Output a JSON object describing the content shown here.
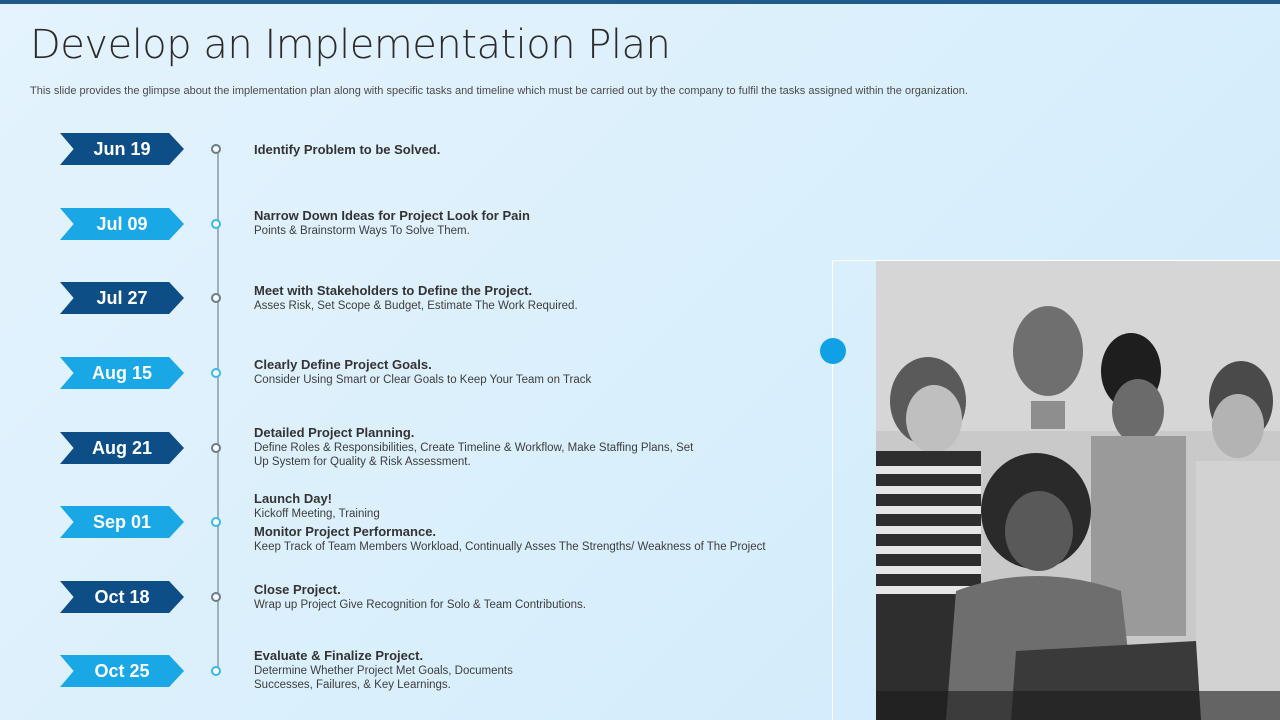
{
  "slide": {
    "title": "Develop an Implementation Plan",
    "subtitle": "This slide provides the glimpse about the implementation plan along with specific tasks and timeline which must be carried out by the company to fulfil the tasks assigned within the organization."
  },
  "timeline": [
    {
      "date": "Jun 19",
      "style": "dark",
      "heading": "Identify Problem to be Solved.",
      "lines": []
    },
    {
      "date": "Jul 09",
      "style": "light",
      "heading": "Narrow Down Ideas for Project Look for Pain",
      "lines": [
        "Points & Brainstorm Ways To Solve Them."
      ]
    },
    {
      "date": "Jul 27",
      "style": "dark",
      "heading": "Meet with Stakeholders to Define the Project.",
      "lines": [
        "Asses Risk, Set Scope & Budget, Estimate The Work Required."
      ]
    },
    {
      "date": "Aug 15",
      "style": "light",
      "heading": "Clearly Define Project Goals.",
      "lines": [
        "Consider Using Smart or Clear Goals to Keep Your Team on Track"
      ]
    },
    {
      "date": "Aug 21",
      "style": "dark",
      "heading": "Detailed Project Planning.",
      "lines": [
        "Define Roles & Responsibilities, Create Timeline & Workflow, Make Staffing Plans, Set",
        "Up System for Quality & Risk Assessment."
      ]
    },
    {
      "date": "Sep 01",
      "style": "light",
      "heading": "Launch Day!",
      "lines": [
        "Kickoff Meeting, Training"
      ],
      "heading2": "Monitor Project Performance.",
      "lines2": [
        "Keep Track of Team Members Workload, Continually Asses The Strengths/ Weakness of The Project"
      ]
    },
    {
      "date": "Oct 18",
      "style": "dark",
      "heading": "Close Project.",
      "lines": [
        "Wrap up Project Give Recognition for Solo & Team Contributions."
      ]
    },
    {
      "date": "Oct 25",
      "style": "light",
      "heading": "Evaluate & Finalize Project.",
      "lines": [
        "Determine Whether Project Met Goals, Documents",
        "Successes, Failures, & Key Learnings."
      ]
    }
  ],
  "colors": {
    "dark_badge": "#0e4e86",
    "light_badge": "#19a7e6",
    "accent_dot": "#0fa0e6"
  }
}
